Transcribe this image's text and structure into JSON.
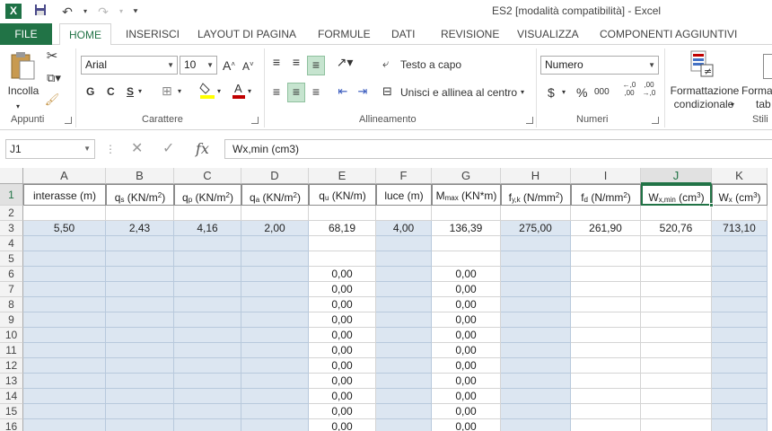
{
  "window": {
    "title": "ES2  [modalità compatibilità] - Excel",
    "app_icon": "X"
  },
  "quick_access": {
    "save_icon": "save-icon",
    "undo_icon": "undo-icon",
    "redo_icon": "redo-icon"
  },
  "tabs": [
    "FILE",
    "HOME",
    "INSERISCI",
    "LAYOUT DI PAGINA",
    "FORMULE",
    "DATI",
    "REVISIONE",
    "VISUALIZZA",
    "COMPONENTI AGGIUNTIVI"
  ],
  "ribbon": {
    "clipboard": {
      "paste_label": "Incolla",
      "group_label": "Appunti"
    },
    "font": {
      "font_name": "Arial",
      "font_size": "10",
      "group_label": "Carattere",
      "bold": "G",
      "italic": "C",
      "underline": "S"
    },
    "alignment": {
      "wrap_text": "Testo a capo",
      "merge_center": "Unisci e allinea al centro",
      "group_label": "Allineamento"
    },
    "number": {
      "format": "Numero",
      "currency": "$",
      "percent": "%",
      "thousands": "000",
      "dec_inc": ",00 →,0",
      "dec_dec": ",0 →,00",
      "group_label": "Numeri"
    },
    "styles": {
      "cond_format_line1": "Formattazione",
      "cond_format_line2": "condizionale",
      "format_table_line1": "Forma",
      "format_table_line2": "tab",
      "group_label": "Stili"
    }
  },
  "formula_bar": {
    "name_box": "J1",
    "fx": "fx",
    "content": "Wx,min (cm3)"
  },
  "columns": [
    "A",
    "B",
    "C",
    "D",
    "E",
    "F",
    "G",
    "H",
    "I",
    "J",
    "K"
  ],
  "rows": [
    "1",
    "2",
    "3",
    "4",
    "5",
    "6",
    "7",
    "8",
    "9",
    "10",
    "11",
    "12",
    "13",
    "14",
    "15",
    "16"
  ],
  "headers": [
    {
      "base": "interasse (m)",
      "sub": "",
      "tail": ""
    },
    {
      "base": "q",
      "sub": "s",
      "tail": " (KN/m",
      "sup": "2",
      "end": ")"
    },
    {
      "base": "q",
      "sub": "p",
      "tail": " (KN/m",
      "sup": "2",
      "end": ")"
    },
    {
      "base": "q",
      "sub": "a",
      "tail": " (KN/m",
      "sup": "2",
      "end": ")"
    },
    {
      "base": "q",
      "sub": "u",
      "tail": " (KN/m)",
      "sup": "",
      "end": ""
    },
    {
      "base": "luce (m)",
      "sub": "",
      "tail": ""
    },
    {
      "base": "M",
      "sub": "max",
      "tail": " (KN*m)",
      "sup": "",
      "end": ""
    },
    {
      "base": "f",
      "sub": "y,k",
      "tail": " (N/mm",
      "sup": "2",
      "end": ")"
    },
    {
      "base": "f",
      "sub": "d",
      "tail": " (N/mm",
      "sup": "2",
      "end": ")"
    },
    {
      "base": "W",
      "sub": "x,min",
      "tail": " (cm",
      "sup": "3",
      "end": ")"
    },
    {
      "base": "W",
      "sub": "x",
      "tail": " (cm",
      "sup": "3",
      "end": ")"
    }
  ],
  "row3": [
    "5,50",
    "2,43",
    "4,16",
    "2,00",
    "68,19",
    "4,00",
    "136,39",
    "275,00",
    "261,90",
    "520,76",
    "713,10"
  ],
  "zero_value": "0,00"
}
